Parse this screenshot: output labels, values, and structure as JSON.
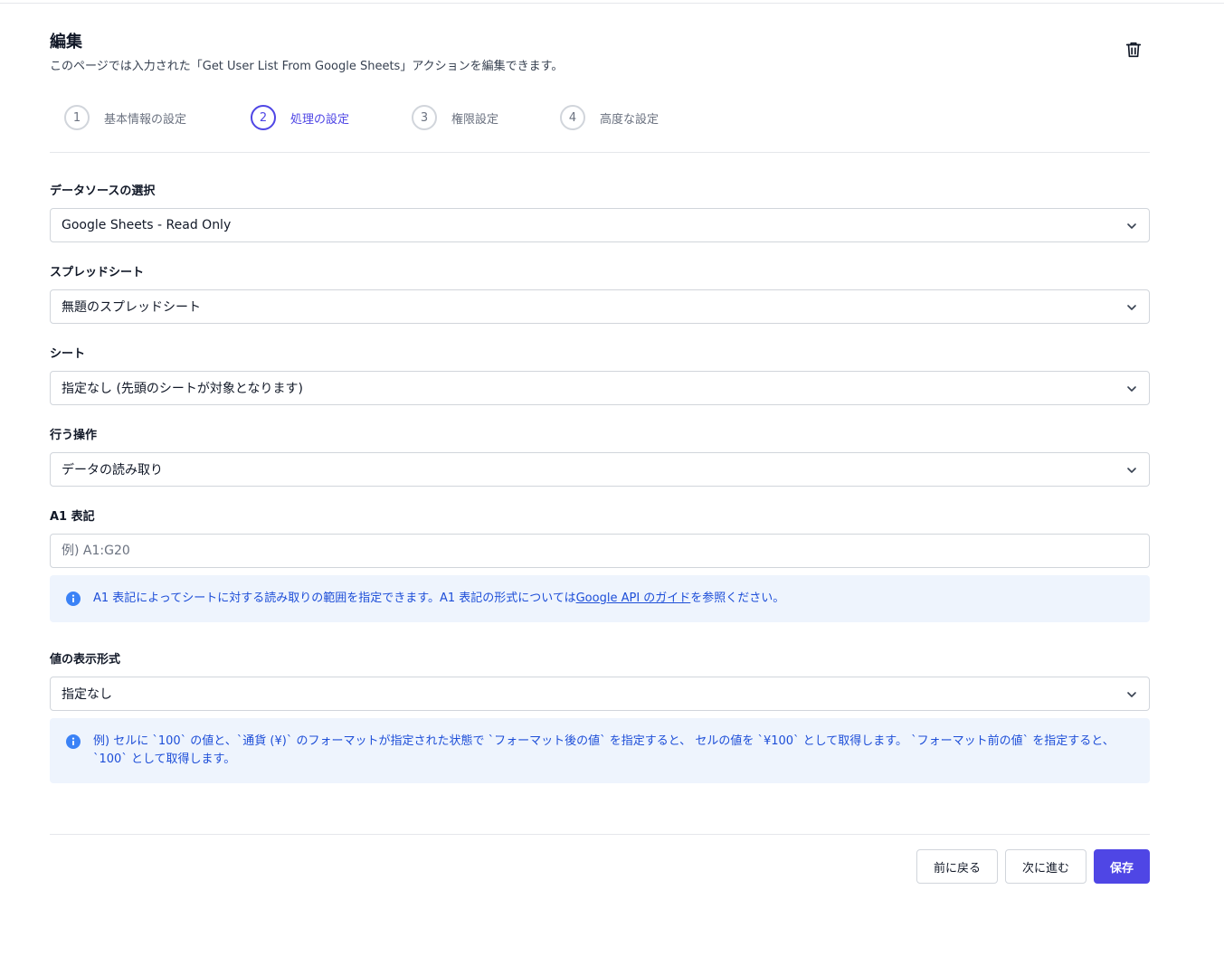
{
  "header": {
    "title": "編集",
    "subtitle": "このページでは入力された「Get User List From Google Sheets」アクションを編集できます。",
    "delete_icon": "trash-icon"
  },
  "steps": [
    {
      "number": "1",
      "label": "基本情報の設定",
      "active": false
    },
    {
      "number": "2",
      "label": "処理の設定",
      "active": true
    },
    {
      "number": "3",
      "label": "権限設定",
      "active": false
    },
    {
      "number": "4",
      "label": "高度な設定",
      "active": false
    }
  ],
  "form": {
    "datasource": {
      "label": "データソースの選択",
      "value": "Google Sheets - Read Only"
    },
    "spreadsheet": {
      "label": "スプレッドシート",
      "value": "無題のスプレッドシート"
    },
    "sheet": {
      "label": "シート",
      "value": "指定なし (先頭のシートが対象となります)"
    },
    "operation": {
      "label": "行う操作",
      "value": "データの読み取り"
    },
    "a1": {
      "label": "A1 表記",
      "placeholder": "例) A1:G20",
      "value": "",
      "info_before": "A1 表記によってシートに対する読み取りの範囲を指定できます。A1 表記の形式については",
      "info_link": "Google API のガイド",
      "info_after": "を参照ください。"
    },
    "value_format": {
      "label": "値の表示形式",
      "value": "指定なし",
      "info": "例) セルに `100` の値と、`通貨 (¥)` のフォーマットが指定された状態で `フォーマット後の値` を指定すると、 セルの値を `¥100` として取得します。 `フォーマット前の値` を指定すると、 `100` として取得します。"
    }
  },
  "footer": {
    "back_label": "前に戻る",
    "next_label": "次に進む",
    "save_label": "保存"
  },
  "colors": {
    "accent": "#4f46e5",
    "info_bg": "#eef4fd",
    "info_text": "#1d4ed8"
  }
}
